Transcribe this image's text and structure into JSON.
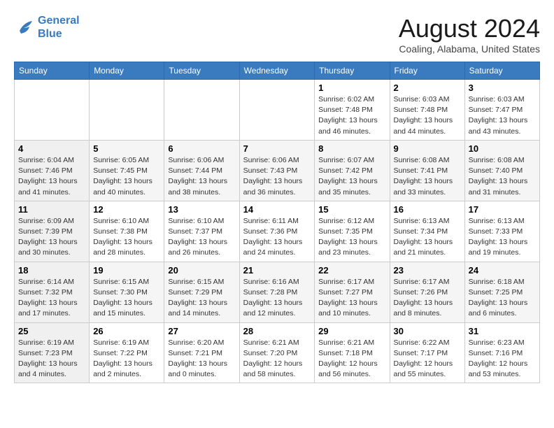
{
  "logo": {
    "line1": "General",
    "line2": "Blue"
  },
  "title": "August 2024",
  "subtitle": "Coaling, Alabama, United States",
  "weekdays": [
    "Sunday",
    "Monday",
    "Tuesday",
    "Wednesday",
    "Thursday",
    "Friday",
    "Saturday"
  ],
  "weeks": [
    [
      {
        "day": "",
        "info": ""
      },
      {
        "day": "",
        "info": ""
      },
      {
        "day": "",
        "info": ""
      },
      {
        "day": "",
        "info": ""
      },
      {
        "day": "1",
        "info": "Sunrise: 6:02 AM\nSunset: 7:48 PM\nDaylight: 13 hours\nand 46 minutes."
      },
      {
        "day": "2",
        "info": "Sunrise: 6:03 AM\nSunset: 7:48 PM\nDaylight: 13 hours\nand 44 minutes."
      },
      {
        "day": "3",
        "info": "Sunrise: 6:03 AM\nSunset: 7:47 PM\nDaylight: 13 hours\nand 43 minutes."
      }
    ],
    [
      {
        "day": "4",
        "info": "Sunrise: 6:04 AM\nSunset: 7:46 PM\nDaylight: 13 hours\nand 41 minutes."
      },
      {
        "day": "5",
        "info": "Sunrise: 6:05 AM\nSunset: 7:45 PM\nDaylight: 13 hours\nand 40 minutes."
      },
      {
        "day": "6",
        "info": "Sunrise: 6:06 AM\nSunset: 7:44 PM\nDaylight: 13 hours\nand 38 minutes."
      },
      {
        "day": "7",
        "info": "Sunrise: 6:06 AM\nSunset: 7:43 PM\nDaylight: 13 hours\nand 36 minutes."
      },
      {
        "day": "8",
        "info": "Sunrise: 6:07 AM\nSunset: 7:42 PM\nDaylight: 13 hours\nand 35 minutes."
      },
      {
        "day": "9",
        "info": "Sunrise: 6:08 AM\nSunset: 7:41 PM\nDaylight: 13 hours\nand 33 minutes."
      },
      {
        "day": "10",
        "info": "Sunrise: 6:08 AM\nSunset: 7:40 PM\nDaylight: 13 hours\nand 31 minutes."
      }
    ],
    [
      {
        "day": "11",
        "info": "Sunrise: 6:09 AM\nSunset: 7:39 PM\nDaylight: 13 hours\nand 30 minutes."
      },
      {
        "day": "12",
        "info": "Sunrise: 6:10 AM\nSunset: 7:38 PM\nDaylight: 13 hours\nand 28 minutes."
      },
      {
        "day": "13",
        "info": "Sunrise: 6:10 AM\nSunset: 7:37 PM\nDaylight: 13 hours\nand 26 minutes."
      },
      {
        "day": "14",
        "info": "Sunrise: 6:11 AM\nSunset: 7:36 PM\nDaylight: 13 hours\nand 24 minutes."
      },
      {
        "day": "15",
        "info": "Sunrise: 6:12 AM\nSunset: 7:35 PM\nDaylight: 13 hours\nand 23 minutes."
      },
      {
        "day": "16",
        "info": "Sunrise: 6:13 AM\nSunset: 7:34 PM\nDaylight: 13 hours\nand 21 minutes."
      },
      {
        "day": "17",
        "info": "Sunrise: 6:13 AM\nSunset: 7:33 PM\nDaylight: 13 hours\nand 19 minutes."
      }
    ],
    [
      {
        "day": "18",
        "info": "Sunrise: 6:14 AM\nSunset: 7:32 PM\nDaylight: 13 hours\nand 17 minutes."
      },
      {
        "day": "19",
        "info": "Sunrise: 6:15 AM\nSunset: 7:30 PM\nDaylight: 13 hours\nand 15 minutes."
      },
      {
        "day": "20",
        "info": "Sunrise: 6:15 AM\nSunset: 7:29 PM\nDaylight: 13 hours\nand 14 minutes."
      },
      {
        "day": "21",
        "info": "Sunrise: 6:16 AM\nSunset: 7:28 PM\nDaylight: 13 hours\nand 12 minutes."
      },
      {
        "day": "22",
        "info": "Sunrise: 6:17 AM\nSunset: 7:27 PM\nDaylight: 13 hours\nand 10 minutes."
      },
      {
        "day": "23",
        "info": "Sunrise: 6:17 AM\nSunset: 7:26 PM\nDaylight: 13 hours\nand 8 minutes."
      },
      {
        "day": "24",
        "info": "Sunrise: 6:18 AM\nSunset: 7:25 PM\nDaylight: 13 hours\nand 6 minutes."
      }
    ],
    [
      {
        "day": "25",
        "info": "Sunrise: 6:19 AM\nSunset: 7:23 PM\nDaylight: 13 hours\nand 4 minutes."
      },
      {
        "day": "26",
        "info": "Sunrise: 6:19 AM\nSunset: 7:22 PM\nDaylight: 13 hours\nand 2 minutes."
      },
      {
        "day": "27",
        "info": "Sunrise: 6:20 AM\nSunset: 7:21 PM\nDaylight: 13 hours\nand 0 minutes."
      },
      {
        "day": "28",
        "info": "Sunrise: 6:21 AM\nSunset: 7:20 PM\nDaylight: 12 hours\nand 58 minutes."
      },
      {
        "day": "29",
        "info": "Sunrise: 6:21 AM\nSunset: 7:18 PM\nDaylight: 12 hours\nand 56 minutes."
      },
      {
        "day": "30",
        "info": "Sunrise: 6:22 AM\nSunset: 7:17 PM\nDaylight: 12 hours\nand 55 minutes."
      },
      {
        "day": "31",
        "info": "Sunrise: 6:23 AM\nSunset: 7:16 PM\nDaylight: 12 hours\nand 53 minutes."
      }
    ]
  ]
}
